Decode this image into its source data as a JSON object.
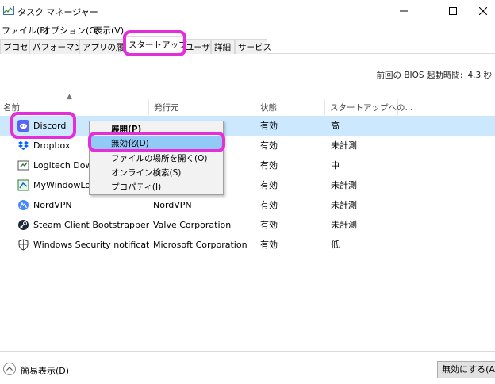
{
  "window": {
    "title": "タスク マネージャー"
  },
  "menu": [
    "ファイル(F)",
    "オプション(O)",
    "表示(V)"
  ],
  "tabs": [
    "プロセス",
    "パフォーマンス",
    "アプリの履歴",
    "スタートアップ",
    "ユーザー",
    "詳細",
    "サービス"
  ],
  "active_tab": "スタートアップ",
  "bios": {
    "label": "前回の BIOS 起動時間:",
    "value": "4.3 秒"
  },
  "columns": [
    "名前",
    "発行元",
    "状態",
    "スタートアップへの..."
  ],
  "rows": [
    {
      "name": "Discord",
      "publisher": "",
      "status": "有効",
      "impact": "高",
      "icon": "discord-icon",
      "selected": true
    },
    {
      "name": "Dropbox",
      "publisher": "",
      "status": "有効",
      "impact": "未計測",
      "icon": "dropbox-icon"
    },
    {
      "name": "Logitech Download Assistant",
      "publisher": "",
      "status": "有効",
      "impact": "中",
      "icon": "logitech-icon"
    },
    {
      "name": "MyWindowLogger",
      "publisher": "",
      "status": "有効",
      "impact": "未計測",
      "icon": "app-icon"
    },
    {
      "name": "NordVPN",
      "publisher": "NordVPN",
      "status": "有効",
      "impact": "未計測",
      "icon": "nordvpn-icon"
    },
    {
      "name": "Steam Client Bootstrapper",
      "publisher": "Valve Corporation",
      "status": "有効",
      "impact": "未計測",
      "icon": "steam-icon"
    },
    {
      "name": "Windows Security notificatio...",
      "publisher": "Microsoft Corporation",
      "status": "有効",
      "impact": "低",
      "icon": "shield-icon"
    }
  ],
  "context_menu": [
    "展開(P)",
    "無効化(D)",
    "ファイルの場所を開く(O)",
    "オンライン検索(S)",
    "プロパティ(I)"
  ],
  "footer": {
    "fewer_details": "簡易表示(D)",
    "disable_button": "無効にする(A)"
  },
  "colors": {
    "highlight_annotation": "#e62ddc",
    "selected_row": "#cce8ff",
    "menu_highlight": "#91c9f7"
  }
}
